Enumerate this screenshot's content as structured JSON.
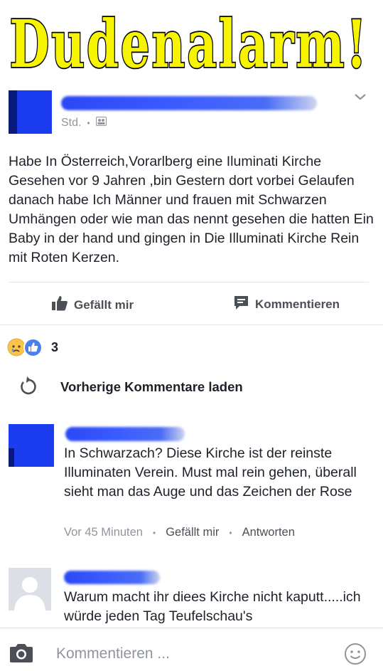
{
  "banner": {
    "title": "Dudenalarm!",
    "text_color": "#f7f400",
    "outline_color": "#000000"
  },
  "post": {
    "time_text": "Std.",
    "separator": "•",
    "body": "Habe In Österreich,Vorarlberg eine Iluminati Kirche Gesehen vor 9 Jahren ,bin Gestern dort vorbei Gelaufen danach habe Ich Männer und frauen mit Schwarzen Umhängen oder wie man das nennt gesehen die hatten Ein Baby in der hand und gingen in Die Illuminati Kirche Rein mit Roten Kerzen."
  },
  "actions": {
    "like_label": "Gefällt mir",
    "comment_label": "Kommentieren"
  },
  "reactions": {
    "count": "3"
  },
  "load_previous": {
    "label": "Vorherige Kommentare laden"
  },
  "comments": [
    {
      "text": "In Schwarzach? Diese Kirche ist der reinste Illuminaten Verein. Must mal rein gehen, überall sieht man das Auge und das Zeichen der Rose",
      "time": "Vor 45 Minuten",
      "like_label": "Gefällt mir",
      "reply_label": "Antworten",
      "separator": "•"
    },
    {
      "text": "Warum macht ihr diees Kirche nicht kaputt.....ich würde jeden Tag Teufelschau's"
    }
  ],
  "composer": {
    "placeholder": "Kommentieren ..."
  },
  "colors": {
    "brand_blue": "#4267b2",
    "name_blur": "#2a48f5"
  }
}
